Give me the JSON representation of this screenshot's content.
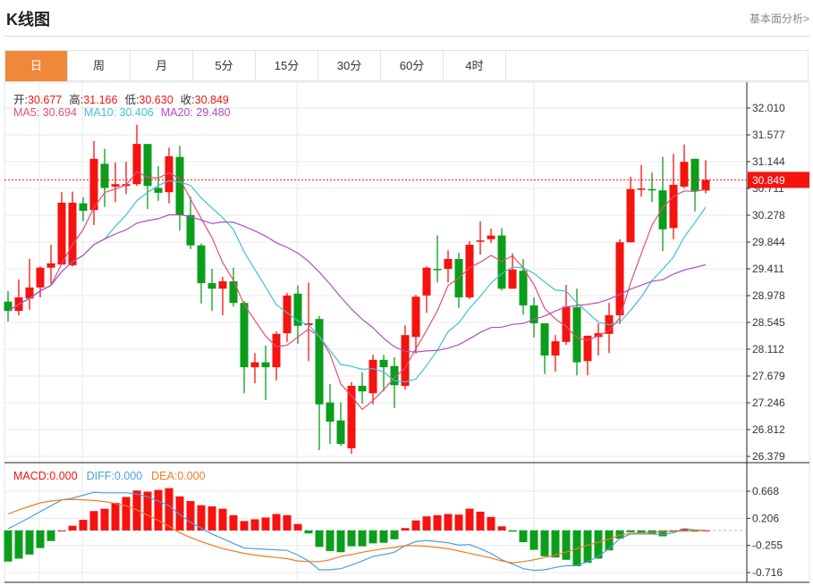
{
  "header": {
    "title": "K线图",
    "link": "基本面分析>"
  },
  "tabs": [
    {
      "label": "日",
      "active": true
    },
    {
      "label": "周"
    },
    {
      "label": "月"
    },
    {
      "label": "5分"
    },
    {
      "label": "15分"
    },
    {
      "label": "30分"
    },
    {
      "label": "60分"
    },
    {
      "label": "4时"
    }
  ],
  "ohlc_info": {
    "open_label": "开:",
    "open": "30.677",
    "high_label": "高:",
    "high": "31.166",
    "low_label": "低:",
    "low": "30.630",
    "close_label": "收:",
    "close": "30.849"
  },
  "ma_info": {
    "ma5_label": "MA5:",
    "ma5": "30.694",
    "ma10_label": "MA10:",
    "ma10": "30.406",
    "ma20_label": "MA20:",
    "ma20": "29.480"
  },
  "macd_info": {
    "macd_label": "MACD:",
    "macd": "0.000",
    "diff_label": "DIFF:",
    "diff": "0.000",
    "dea_label": "DEA:",
    "dea": "0.000"
  },
  "colors": {
    "up": "#f5130f",
    "down": "#0a9e1a",
    "ma5": "#e0507a",
    "ma10": "#3fbfd8",
    "ma20": "#b04fc0",
    "diff": "#4a9fe0",
    "dea": "#f07a20",
    "active_tab": "#f0883a"
  },
  "chart_data": [
    {
      "type": "candlestick",
      "y_ticks": [
        "32.010",
        "31.577",
        "31.144",
        "30.711",
        "30.278",
        "29.844",
        "29.411",
        "28.978",
        "28.545",
        "28.112",
        "27.679",
        "27.246",
        "26.812",
        "26.379"
      ],
      "ylim": [
        26.379,
        32.01
      ],
      "grid": true,
      "last_price": "30.849",
      "ma_periods": [
        5,
        10,
        20
      ],
      "candles": [
        [
          28.88,
          29.05,
          28.56,
          28.73
        ],
        [
          28.73,
          29.24,
          28.66,
          28.95
        ],
        [
          28.93,
          29.57,
          28.75,
          29.11
        ],
        [
          29.11,
          29.45,
          28.95,
          29.43
        ],
        [
          29.43,
          29.8,
          29.17,
          29.5
        ],
        [
          29.48,
          30.65,
          29.48,
          30.48
        ],
        [
          29.47,
          30.66,
          29.45,
          30.48
        ],
        [
          30.47,
          30.57,
          30.18,
          30.35
        ],
        [
          30.36,
          31.48,
          30.12,
          31.19
        ],
        [
          31.11,
          31.35,
          30.41,
          30.72
        ],
        [
          30.74,
          31.13,
          30.49,
          30.78
        ],
        [
          30.75,
          31.14,
          30.62,
          30.78
        ],
        [
          30.78,
          31.74,
          30.75,
          31.43
        ],
        [
          31.43,
          31.43,
          30.38,
          30.75
        ],
        [
          30.72,
          31.07,
          30.51,
          30.64
        ],
        [
          30.65,
          31.37,
          30.47,
          31.23
        ],
        [
          31.22,
          31.4,
          30.03,
          30.28
        ],
        [
          30.28,
          30.58,
          29.73,
          29.79
        ],
        [
          29.79,
          29.82,
          28.85,
          29.18
        ],
        [
          29.18,
          29.41,
          28.73,
          29.09
        ],
        [
          29.09,
          29.28,
          28.66,
          29.21
        ],
        [
          29.21,
          29.43,
          28.8,
          28.86
        ],
        [
          28.86,
          28.89,
          27.4,
          27.82
        ],
        [
          27.82,
          28.05,
          27.56,
          27.9
        ],
        [
          27.9,
          28.17,
          27.29,
          27.82
        ],
        [
          27.82,
          28.4,
          27.61,
          28.36
        ],
        [
          28.37,
          29.02,
          28.23,
          28.98
        ],
        [
          29.01,
          29.14,
          28.2,
          28.49
        ],
        [
          28.5,
          29.19,
          27.92,
          28.53
        ],
        [
          28.6,
          28.65,
          26.48,
          27.22
        ],
        [
          27.25,
          27.55,
          26.58,
          26.94
        ],
        [
          26.96,
          27.25,
          26.55,
          26.58
        ],
        [
          26.51,
          27.58,
          26.42,
          27.52
        ],
        [
          27.52,
          27.74,
          27.23,
          27.43
        ],
        [
          27.4,
          28.02,
          27.22,
          27.94
        ],
        [
          27.94,
          28.02,
          27.43,
          27.82
        ],
        [
          27.84,
          27.98,
          27.16,
          27.53
        ],
        [
          27.52,
          28.5,
          27.46,
          28.34
        ],
        [
          28.31,
          28.99,
          28.04,
          28.96
        ],
        [
          28.98,
          29.45,
          28.7,
          29.43
        ],
        [
          29.41,
          29.95,
          29.19,
          29.4
        ],
        [
          29.41,
          29.71,
          29.19,
          29.57
        ],
        [
          29.57,
          29.67,
          28.78,
          28.95
        ],
        [
          28.95,
          29.86,
          28.92,
          29.8
        ],
        [
          29.86,
          30.18,
          29.64,
          29.87
        ],
        [
          29.89,
          30.06,
          29.83,
          29.95
        ],
        [
          29.95,
          30.07,
          29.06,
          29.09
        ],
        [
          29.09,
          29.66,
          29.09,
          29.4
        ],
        [
          29.38,
          29.57,
          28.67,
          28.82
        ],
        [
          28.82,
          28.95,
          28.3,
          28.53
        ],
        [
          28.53,
          28.53,
          27.71,
          28.01
        ],
        [
          28.01,
          28.34,
          27.75,
          28.24
        ],
        [
          28.23,
          29.15,
          28.18,
          28.8
        ],
        [
          28.79,
          29.09,
          27.69,
          27.9
        ],
        [
          27.92,
          28.33,
          27.69,
          28.33
        ],
        [
          28.31,
          28.53,
          28.01,
          28.37
        ],
        [
          28.36,
          28.86,
          28.05,
          28.66
        ],
        [
          28.66,
          29.89,
          28.52,
          29.84
        ],
        [
          29.84,
          30.9,
          29.84,
          30.7
        ],
        [
          30.7,
          31.09,
          30.58,
          30.71
        ],
        [
          30.7,
          30.97,
          30.49,
          30.68
        ],
        [
          30.68,
          31.22,
          29.7,
          30.05
        ],
        [
          30.07,
          31.27,
          29.89,
          30.77
        ],
        [
          30.74,
          31.42,
          30.71,
          31.14
        ],
        [
          31.19,
          31.19,
          30.34,
          30.67
        ],
        [
          30.677,
          31.166,
          30.63,
          30.849
        ]
      ]
    },
    {
      "type": "bar+line",
      "y_ticks": [
        "0.668",
        "0.206",
        "-0.255",
        "-0.716"
      ],
      "ylim": [
        -0.716,
        0.668
      ],
      "macd": [
        -0.53,
        -0.48,
        -0.41,
        -0.3,
        -0.18,
        0.0,
        0.08,
        0.18,
        0.33,
        0.37,
        0.47,
        0.57,
        0.68,
        0.66,
        0.69,
        0.72,
        0.58,
        0.5,
        0.43,
        0.41,
        0.37,
        0.26,
        0.16,
        0.19,
        0.22,
        0.28,
        0.26,
        0.11,
        -0.05,
        -0.28,
        -0.35,
        -0.37,
        -0.27,
        -0.27,
        -0.22,
        -0.21,
        -0.15,
        0.04,
        0.17,
        0.24,
        0.26,
        0.28,
        0.27,
        0.37,
        0.32,
        0.23,
        0.07,
        -0.02,
        -0.2,
        -0.33,
        -0.44,
        -0.46,
        -0.5,
        -0.61,
        -0.55,
        -0.48,
        -0.34,
        -0.14,
        -0.03,
        -0.05,
        -0.06,
        -0.1,
        -0.01,
        0.03,
        -0.02,
        0.0
      ],
      "diff": [
        0.03,
        0.12,
        0.22,
        0.32,
        0.42,
        0.52,
        0.55,
        0.6,
        0.65,
        0.64,
        0.64,
        0.64,
        0.62,
        0.57,
        0.5,
        0.42,
        0.27,
        0.14,
        0.04,
        -0.06,
        -0.14,
        -0.22,
        -0.3,
        -0.31,
        -0.32,
        -0.33,
        -0.34,
        -0.42,
        -0.52,
        -0.67,
        -0.67,
        -0.65,
        -0.59,
        -0.52,
        -0.44,
        -0.41,
        -0.37,
        -0.26,
        -0.19,
        -0.17,
        -0.19,
        -0.21,
        -0.25,
        -0.24,
        -0.31,
        -0.39,
        -0.5,
        -0.57,
        -0.65,
        -0.68,
        -0.67,
        -0.63,
        -0.6,
        -0.6,
        -0.53,
        -0.44,
        -0.31,
        -0.14,
        -0.06,
        -0.06,
        -0.06,
        -0.07,
        -0.04,
        0.03,
        0.01,
        0.0
      ],
      "dea": [
        0.28,
        0.35,
        0.41,
        0.47,
        0.5,
        0.52,
        0.53,
        0.52,
        0.51,
        0.49,
        0.46,
        0.42,
        0.35,
        0.26,
        0.17,
        0.07,
        -0.04,
        -0.12,
        -0.19,
        -0.25,
        -0.31,
        -0.35,
        -0.39,
        -0.42,
        -0.44,
        -0.46,
        -0.48,
        -0.52,
        -0.53,
        -0.53,
        -0.5,
        -0.44,
        -0.41,
        -0.37,
        -0.34,
        -0.31,
        -0.29,
        -0.26,
        -0.26,
        -0.27,
        -0.29,
        -0.31,
        -0.35,
        -0.39,
        -0.43,
        -0.47,
        -0.52,
        -0.55,
        -0.53,
        -0.5,
        -0.46,
        -0.42,
        -0.37,
        -0.31,
        -0.25,
        -0.2,
        -0.15,
        -0.08,
        -0.05,
        -0.04,
        -0.03,
        -0.02,
        -0.02,
        -0.01,
        0.0,
        0.0
      ]
    }
  ]
}
